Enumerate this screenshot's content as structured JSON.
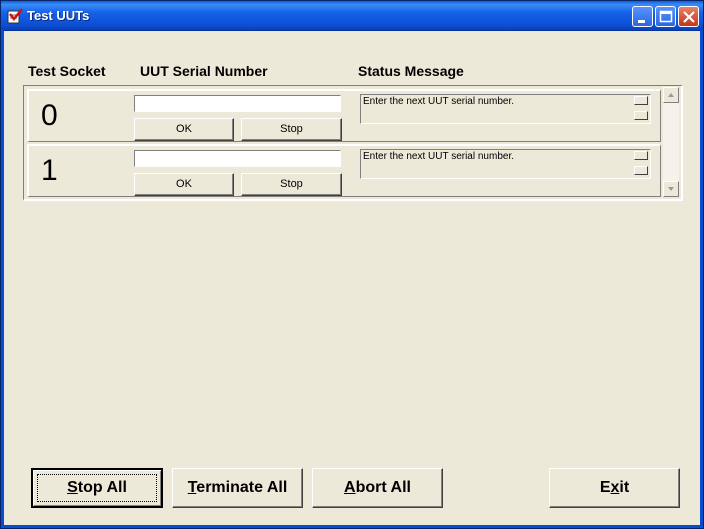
{
  "window": {
    "title": "Test UUTs"
  },
  "columns": {
    "socket": "Test Socket",
    "serial": "UUT Serial Number",
    "status": "Status Message"
  },
  "sockets": [
    {
      "number": "0",
      "serial_value": "",
      "ok_label": "OK",
      "stop_label": "Stop",
      "status": "Enter the next UUT serial number."
    },
    {
      "number": "1",
      "serial_value": "",
      "ok_label": "OK",
      "stop_label": "Stop",
      "status": "Enter the next UUT serial number."
    }
  ],
  "buttons": {
    "stop_all": {
      "key": "S",
      "rest": "top All"
    },
    "terminate_all": {
      "key": "T",
      "rest": "erminate All"
    },
    "abort_all": {
      "key": "A",
      "rest": "bort All"
    },
    "exit": {
      "pre": "E",
      "key": "x",
      "rest": "it"
    }
  },
  "icons": {
    "app": "checklist-icon",
    "minimize": "minimize-icon",
    "maximize": "maximize-icon",
    "close": "close-icon"
  }
}
